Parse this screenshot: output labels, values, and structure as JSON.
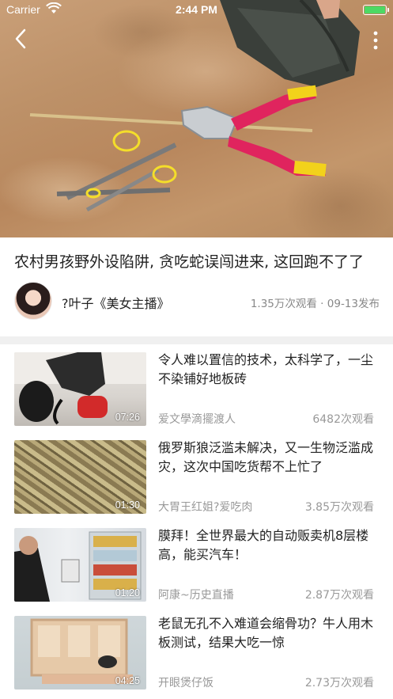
{
  "status_bar": {
    "carrier": "Carrier",
    "time": "2:44 PM"
  },
  "video": {
    "title": "农村男孩野外设陷阱, 贪吃蛇误闯进来, 这回跑不了了",
    "author": "?叶子《美女主播》",
    "meta": "1.35万次观看 · 09-13发布"
  },
  "related": [
    {
      "title": "令人难以置信的技术，太科学了，一尘不染铺好地板砖",
      "author": "爱文學滴擺渡人",
      "views": "6482次观看",
      "duration": "07:26"
    },
    {
      "title": "俄罗斯狼泛滥未解决，又一生物泛滥成灾，这次中国吃货帮不上忙了",
      "author": "大胃王红姐?爱吃肉",
      "views": "3.85万次观看",
      "duration": "01:30"
    },
    {
      "title": "膜拜！全世界最大的自动贩卖机8层楼高，能买汽车！",
      "author": "阿康~历史直播",
      "views": "2.87万次观看",
      "duration": "01:20"
    },
    {
      "title": "老鼠无孔不入难道会缩骨功？牛人用木板测试，结果大吃一惊",
      "author": "开眼煲仔饭",
      "views": "2.73万次观看",
      "duration": "04:25"
    }
  ],
  "colors": {
    "battery": "#4cd964",
    "meta_text": "#888888",
    "divider": "#f0f0f0"
  }
}
